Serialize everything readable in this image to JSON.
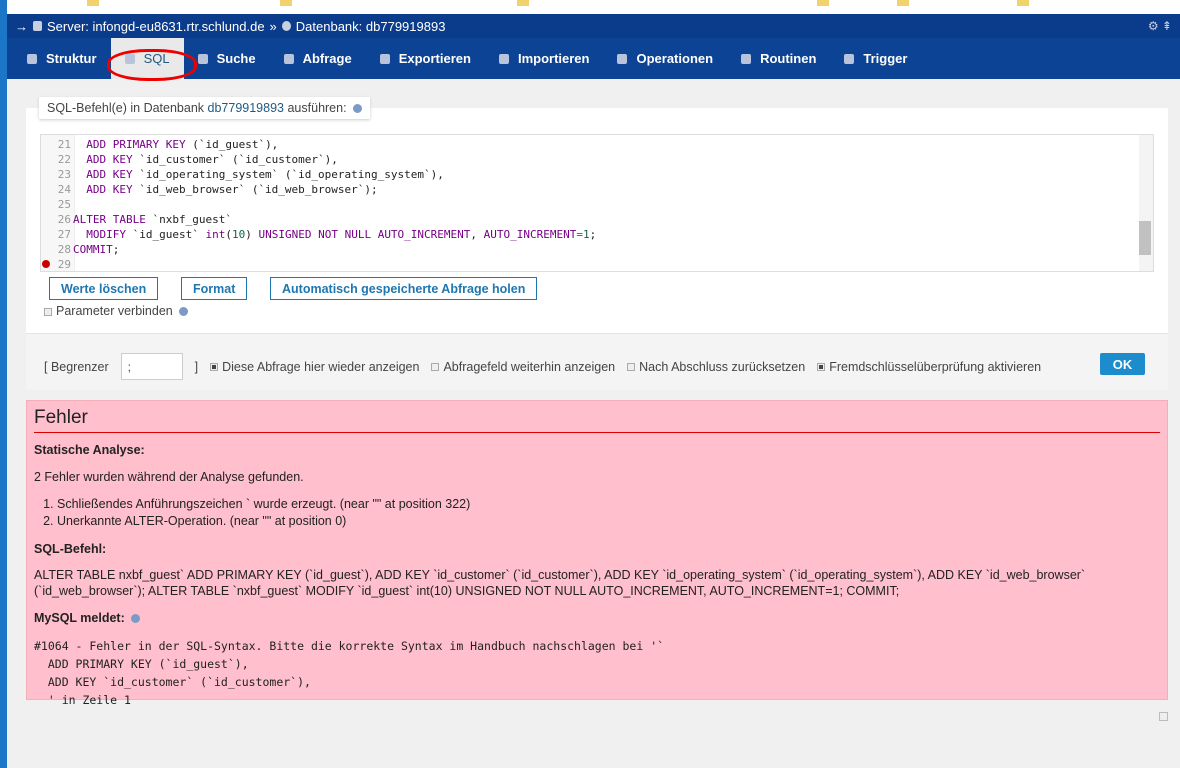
{
  "breadcrumb": {
    "server_label": "Server:",
    "server": "infongd-eu8631.rtr.schlund.de",
    "sep": "»",
    "db_label": "Datenbank:",
    "db": "db779919893"
  },
  "tabs": [
    {
      "label": "Struktur",
      "active": false
    },
    {
      "label": "SQL",
      "active": true
    },
    {
      "label": "Suche",
      "active": false
    },
    {
      "label": "Abfrage",
      "active": false
    },
    {
      "label": "Exportieren",
      "active": false
    },
    {
      "label": "Importieren",
      "active": false
    },
    {
      "label": "Operationen",
      "active": false
    },
    {
      "label": "Routinen",
      "active": false
    },
    {
      "label": "Trigger",
      "active": false
    }
  ],
  "sql_panel": {
    "legend_prefix": "SQL-Befehl(e) in Datenbank",
    "legend_db": "db779919893",
    "legend_suffix": "ausführen:"
  },
  "editor": {
    "lines": [
      {
        "n": "21",
        "t": [
          [
            "  "
          ],
          [
            "ADD PRIMARY KEY",
            "kw"
          ],
          [
            " (`id_guest`),"
          ]
        ]
      },
      {
        "n": "22",
        "t": [
          [
            "  "
          ],
          [
            "ADD KEY",
            "kw"
          ],
          [
            " `id_customer` (`id_customer`),"
          ]
        ]
      },
      {
        "n": "23",
        "t": [
          [
            "  "
          ],
          [
            "ADD KEY",
            "kw"
          ],
          [
            " `id_operating_system` (`id_operating_system`),"
          ]
        ]
      },
      {
        "n": "24",
        "t": [
          [
            "  "
          ],
          [
            "ADD KEY",
            "kw"
          ],
          [
            " `id_web_browser` (`id_web_browser`);"
          ]
        ]
      },
      {
        "n": "25",
        "t": []
      },
      {
        "n": "26",
        "t": [
          [
            "ALTER TABLE",
            "kw"
          ],
          [
            " `nxbf_guest`"
          ]
        ]
      },
      {
        "n": "27",
        "t": [
          [
            "  "
          ],
          [
            "MODIFY",
            "kw"
          ],
          [
            " `id_guest` "
          ],
          [
            "int",
            "kw"
          ],
          [
            "("
          ],
          [
            "10",
            "num"
          ],
          [
            ") "
          ],
          [
            "UNSIGNED NOT NULL AUTO_INCREMENT",
            "kw"
          ],
          [
            ", "
          ],
          [
            "AUTO_INCREMENT",
            "kw"
          ],
          [
            "=",
            "op"
          ],
          [
            "1",
            "num"
          ],
          [
            ";"
          ]
        ]
      },
      {
        "n": "28",
        "t": [
          [
            "COMMIT",
            "kw"
          ],
          [
            ";"
          ]
        ]
      },
      {
        "n": "29",
        "t": [],
        "error": true
      }
    ]
  },
  "buttons": {
    "clear": "Werte löschen",
    "format": "Format",
    "autosave": "Automatisch gespeicherte Abfrage holen"
  },
  "bind_params": {
    "label": "Parameter verbinden",
    "checked": false
  },
  "options": {
    "delimiter_label_open": "[ Begrenzer",
    "delimiter_value": ";",
    "delimiter_label_close": "]",
    "show_query": "Diese Abfrage hier wieder anzeigen",
    "retain_box": "Abfragefeld weiterhin anzeigen",
    "rollback": "Nach Abschluss zurücksetzen",
    "fk_checks": "Fremdschlüsselüberprüfung aktivieren",
    "ok": "OK"
  },
  "error": {
    "title": "Fehler",
    "static_heading": "Statische Analyse:",
    "static_summary": "2 Fehler wurden während der Analyse gefunden.",
    "static_items": [
      "Schließendes Anführungszeichen ` wurde erzeugt. (near \"\" at position 322)",
      "Unerkannte ALTER-Operation. (near \"\" at position 0)"
    ],
    "sql_heading": "SQL-Befehl:",
    "sql_text": "ALTER TABLE nxbf_guest` ADD PRIMARY KEY (`id_guest`), ADD KEY `id_customer` (`id_customer`), ADD KEY `id_operating_system` (`id_operating_system`), ADD KEY `id_web_browser` (`id_web_browser`); ALTER TABLE `nxbf_guest` MODIFY `id_guest` int(10) UNSIGNED NOT NULL AUTO_INCREMENT, AUTO_INCREMENT=1; COMMIT;",
    "mysql_heading": "MySQL meldet:",
    "mysql_text": "#1064 - Fehler in der SQL-Syntax. Bitte die korrekte Syntax im Handbuch nachschlagen bei '`\n  ADD PRIMARY KEY (`id_guest`),\n  ADD KEY `id_customer` (`id_customer`),\n  ' in Zeile 1"
  }
}
